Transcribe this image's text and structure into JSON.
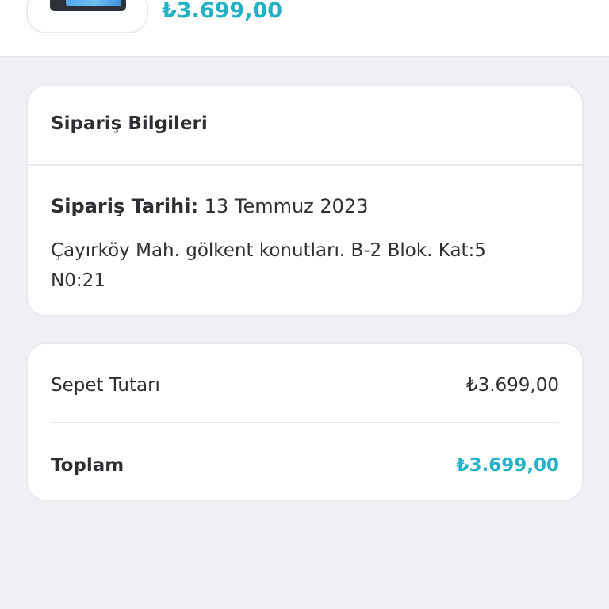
{
  "product": {
    "price": "₺3.699,00",
    "image_icon": "phone-thumbnail"
  },
  "order_info": {
    "title": "Sipariş Bilgileri",
    "date_label": "Sipariş Tarihi:",
    "date_value": "13 Temmuz 2023",
    "address": "Çayırköy Mah. gölkent konutları. B-2 Blok. Kat:5 N0:21"
  },
  "summary": {
    "subtotal_label": "Sepet Tutarı",
    "subtotal_value": "₺3.699,00",
    "total_label": "Toplam",
    "total_value": "₺3.699,00"
  },
  "colors": {
    "accent": "#23b1c6",
    "background": "#eef0f4",
    "card": "#ffffff",
    "text": "#2f2f33"
  }
}
